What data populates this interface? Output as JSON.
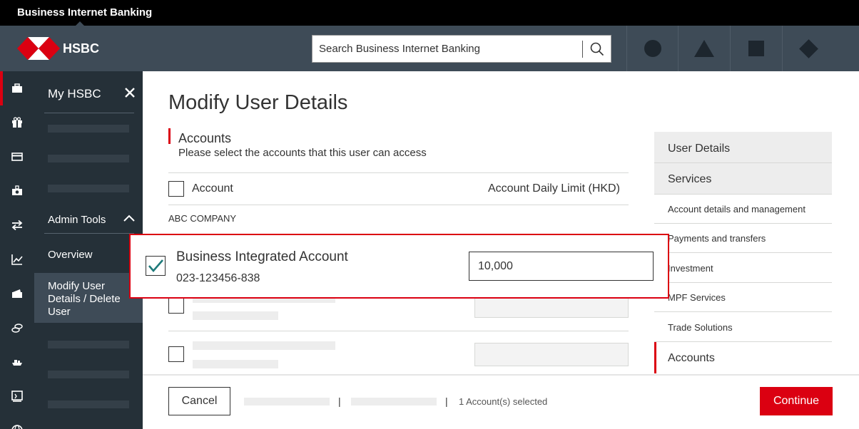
{
  "app": {
    "title": "Business Internet Banking",
    "brand": "HSBC"
  },
  "header": {
    "search_placeholder": "Search Business Internet Banking",
    "icons": [
      "circle-icon",
      "triangle-icon",
      "square-icon",
      "diamond-icon"
    ]
  },
  "rail": {
    "icons": [
      "briefcase-icon",
      "gift-icon",
      "card-icon",
      "safe-icon",
      "transfer-icon",
      "chart-icon",
      "wallet-icon",
      "coins-icon",
      "ship-icon",
      "monitor-icon",
      "globe-icon"
    ]
  },
  "nav": {
    "title": "My HSBC",
    "admin_tools": "Admin Tools",
    "overview": "Overview",
    "selected": "Modify User Details / Delete User"
  },
  "main": {
    "title": "Modify User Details",
    "section_title": "Accounts",
    "section_subtitle": "Please select the accounts that this user can access",
    "col_account": "Account",
    "col_limit": "Account Daily Limit (HKD)",
    "company": "ABC COMPANY"
  },
  "highlight": {
    "account_name": "Business Integrated Account",
    "account_number": "023-123456-838",
    "daily_limit": "10,000",
    "checked": true
  },
  "side_nav": {
    "user_details": "User Details",
    "services": "Services",
    "links": [
      "Account details and management",
      "Payments and transfers",
      "Investment",
      "MPF Services",
      "Trade Solutions"
    ],
    "active": "Accounts"
  },
  "footer": {
    "cancel": "Cancel",
    "separator": "|",
    "count": "1 Account(s) selected",
    "continue": "Continue"
  },
  "colors": {
    "accent": "#db0011",
    "header": "#3e4b57",
    "nav": "#253038",
    "check": "#1e7a7a"
  }
}
